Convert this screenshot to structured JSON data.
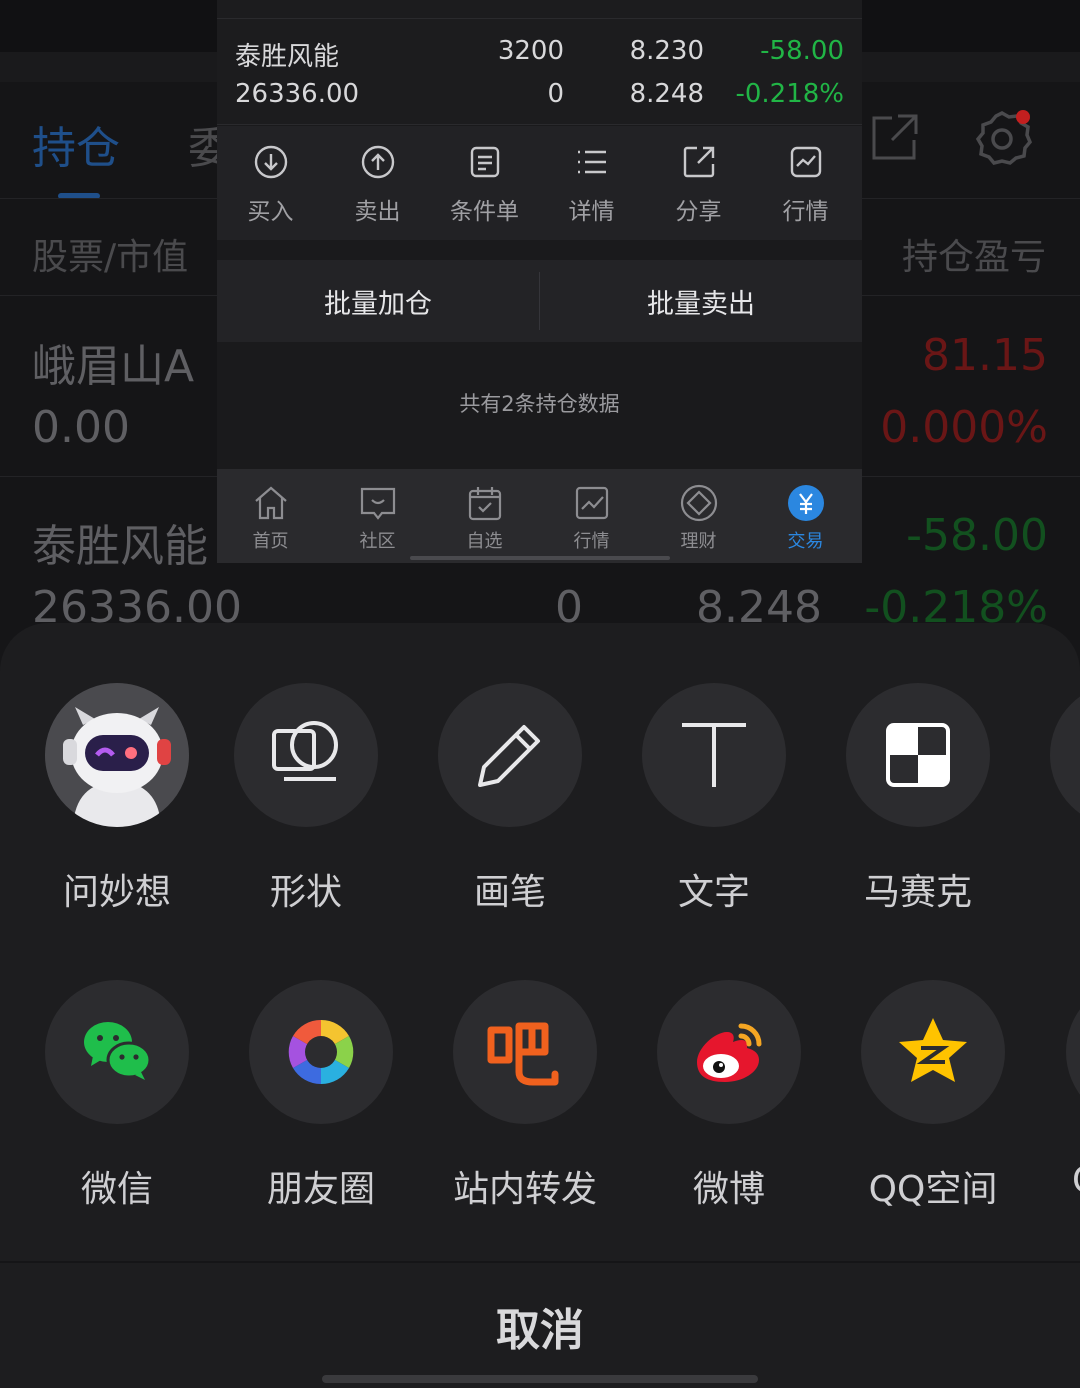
{
  "background": {
    "tabs": [
      "持仓",
      "委"
    ],
    "column_left": "股票/市值",
    "column_right": "持仓盈亏",
    "rows": [
      {
        "name": "峨眉山A",
        "value": "0.00",
        "pnl": "81.15",
        "pnl_pct": "0.000%"
      },
      {
        "name": "泰胜风能",
        "value": "26336.00",
        "qty": "0",
        "price": "8.248",
        "pnl": "-58.00",
        "pnl_pct": "-0.218%"
      }
    ]
  },
  "popup": {
    "row1": {
      "name": "泰胜风能",
      "qty": "3200",
      "price": "8.230",
      "pnl": "-58.00"
    },
    "row2": {
      "value": "26336.00",
      "qty": "0",
      "price": "8.248",
      "pnl_pct": "-0.218%"
    },
    "actions": [
      {
        "label": "买入",
        "icon": "buy-arrow-down-icon"
      },
      {
        "label": "卖出",
        "icon": "sell-arrow-up-icon"
      },
      {
        "label": "条件单",
        "icon": "conditional-order-icon"
      },
      {
        "label": "详情",
        "icon": "list-icon"
      },
      {
        "label": "分享",
        "icon": "share-icon"
      },
      {
        "label": "行情",
        "icon": "chart-icon"
      }
    ],
    "batch_add": "批量加仓",
    "batch_sell": "批量卖出",
    "summary": "共有2条持仓数据",
    "nav": [
      {
        "label": "首页",
        "icon": "home-icon"
      },
      {
        "label": "社区",
        "icon": "community-icon"
      },
      {
        "label": "自选",
        "icon": "watchlist-icon"
      },
      {
        "label": "行情",
        "icon": "market-icon"
      },
      {
        "label": "理财",
        "icon": "wealth-icon"
      },
      {
        "label": "交易",
        "icon": "trade-yen-icon",
        "active": true
      }
    ]
  },
  "share_sheet": {
    "row1": [
      {
        "label": "问妙想",
        "icon": "robot-mascot-icon"
      },
      {
        "label": "形状",
        "icon": "shape-icon"
      },
      {
        "label": "画笔",
        "icon": "pen-icon"
      },
      {
        "label": "文字",
        "icon": "text-icon"
      },
      {
        "label": "马赛克",
        "icon": "mosaic-icon"
      }
    ],
    "row2": [
      {
        "label": "微信",
        "icon": "wechat-icon"
      },
      {
        "label": "朋友圈",
        "icon": "moments-icon"
      },
      {
        "label": "站内转发",
        "icon": "forward-ba-icon"
      },
      {
        "label": "微博",
        "icon": "weibo-icon"
      },
      {
        "label": "QQ空间",
        "icon": "qzone-icon"
      }
    ],
    "partial_label": "Q",
    "cancel": "取消"
  },
  "colors": {
    "accent": "#2b87e0",
    "gain": "#21b546",
    "loss": "#c21f1f"
  }
}
